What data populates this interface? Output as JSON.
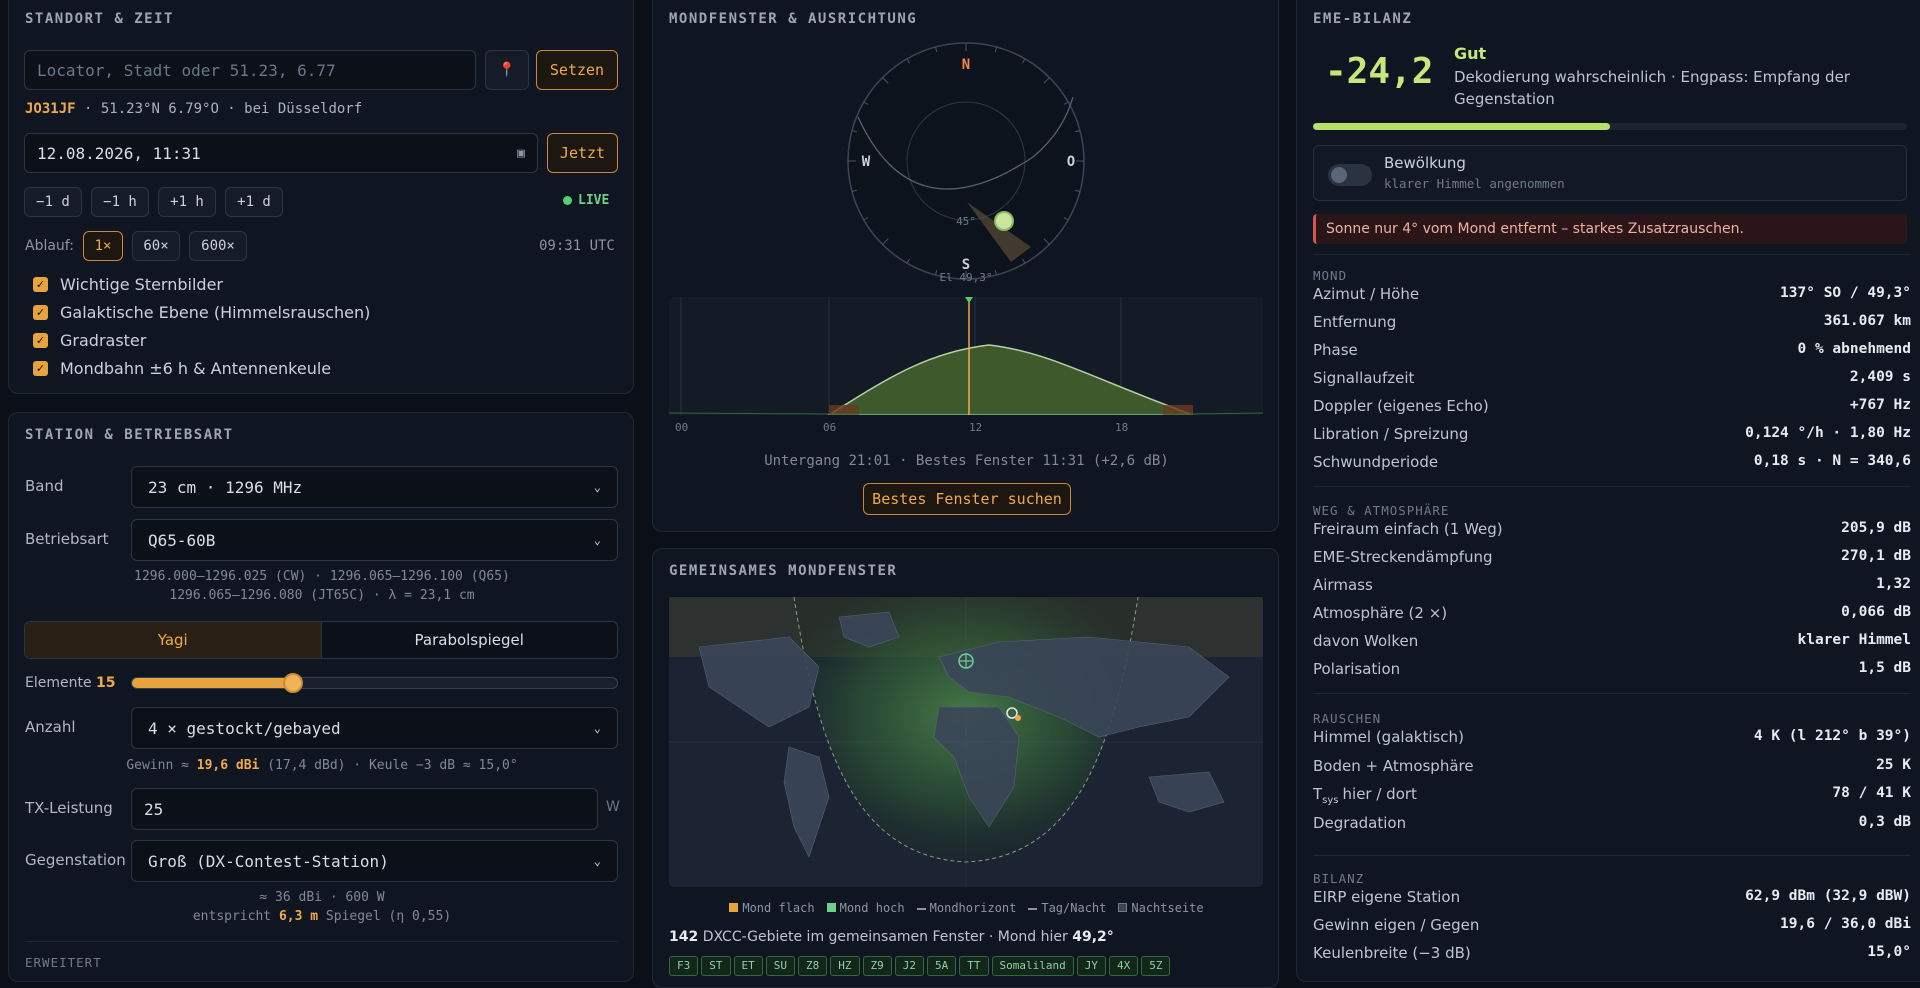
{
  "location": {
    "title": "STANDORT & ZEIT",
    "locator_placeholder": "Locator, Stadt oder 51.23, 6.77",
    "pin_icon": "map-pin-icon",
    "set_label": "Setzen",
    "locator": "JO31JF",
    "coords": "· 51.23°N 6.79°O · bei Düsseldorf",
    "datetime": "12.08.2026, 11:31",
    "now_label": "Jetzt",
    "steps": [
      "−1 d",
      "−1 h",
      "+1 h",
      "+1 d"
    ],
    "live_label": "LIVE",
    "speed_label": "Ablauf:",
    "speeds": [
      "1×",
      "60×",
      "600×"
    ],
    "utc": "09:31 UTC",
    "checks": [
      "Wichtige Sternbilder",
      "Galaktische Ebene (Himmelsrauschen)",
      "Gradraster",
      "Mondbahn ±6 h & Antennenkeule"
    ]
  },
  "station": {
    "title": "STATION & BETRIEBSART",
    "band_label": "Band",
    "band_value": "23 cm · 1296 MHz",
    "mode_label": "Betriebsart",
    "mode_value": "Q65-60B",
    "freq_line1": "1296.000–1296.025 (CW) · 1296.065–1296.100 (Q65)",
    "freq_line2": "1296.065–1296.080 (JT65C) · λ = 23,1 cm",
    "antenna_tabs": [
      "Yagi",
      "Parabolspiegel"
    ],
    "elements_label": "Elemente",
    "elements_value": "15",
    "elements_fraction": 0.33,
    "count_label": "Anzahl",
    "count_value": "4 × gestockt/gebayed",
    "gain_pre": "Gewinn ≈",
    "gain_val": "19,6 dBi",
    "gain_post": "(17,4 dBd) · Keule −3 dB ≈ 15,0°",
    "tx_label": "TX-Leistung",
    "tx_value": "25",
    "tx_unit": "W",
    "peer_label": "Gegenstation",
    "peer_value": "Groß (DX-Contest-Station)",
    "peer_line1": "≈ 36 dBi · 600 W",
    "peer_line2_pre": "entspricht",
    "peer_line2_val": "6,3 m",
    "peer_line2_post": "Spiegel (η 0,55)",
    "advanced": "ERWEITERT"
  },
  "moonwindow": {
    "title": "MONDFENSTER & AUSRICHTUNG",
    "compass": {
      "n": "N",
      "o": "O",
      "s": "S",
      "w": "W",
      "ring45": "45°",
      "el": "El 49,3°"
    },
    "hours": [
      "00",
      "06",
      "12",
      "18"
    ],
    "summary": "Untergang 21:01 · Bestes Fenster 11:31 (+2,6 dB)",
    "best_button": "Bestes Fenster suchen"
  },
  "shared": {
    "title": "GEMEINSAMES MONDFENSTER",
    "legend": [
      "Mond flach",
      "Mond hoch",
      "Mondhorizont",
      "Tag/Nacht",
      "Nachtseite"
    ],
    "count": "142",
    "count_text": "DXCC-Gebiete im gemeinsamen Fenster · Mond hier",
    "moon_el": "49,2°",
    "tags": [
      "F3",
      "ST",
      "ET",
      "SU",
      "Z8",
      "HZ",
      "Z9",
      "J2",
      "5A",
      "TT",
      "Somaliland",
      "JY",
      "4X",
      "5Z"
    ]
  },
  "eme": {
    "title": "EME-BILANZ",
    "margin": "-24,2",
    "verdict": "Gut",
    "verdict_text": "Dekodierung wahrscheinlich · Engpass: Empfang der Gegenstation",
    "bar_fraction": 0.5,
    "cloud_label": "Bewölkung",
    "cloud_sub": "klarer Himmel angenommen",
    "warning": "Sonne nur 4° vom Mond entfernt – starkes Zusatzrauschen.",
    "sections": {
      "moon": "MOND",
      "path": "WEG & ATMOSPHÄRE",
      "noise": "RAUSCHEN",
      "budget": "BILANZ"
    },
    "moon_rows": [
      [
        "Azimut / Höhe",
        "137° SO / 49,3°"
      ],
      [
        "Entfernung",
        "361.067 km"
      ],
      [
        "Phase",
        "0 % abnehmend"
      ],
      [
        "Signallaufzeit",
        "2,409 s"
      ],
      [
        "Doppler (eigenes Echo)",
        "+767 Hz"
      ],
      [
        "Libration / Spreizung",
        "0,124 °/h · 1,80 Hz"
      ],
      [
        "Schwundperiode",
        "0,18 s · N = 340,6"
      ]
    ],
    "path_rows": [
      [
        "Freiraum einfach (1 Weg)",
        "205,9 dB"
      ],
      [
        "EME-Streckendämpfung",
        "270,1 dB"
      ],
      [
        "Airmass",
        "1,32"
      ],
      [
        "Atmosphäre (2 ×)",
        "0,066 dB"
      ],
      [
        "davon Wolken",
        "klarer Himmel"
      ],
      [
        "Polarisation",
        "1,5 dB"
      ]
    ],
    "noise_rows": [
      [
        "Himmel (galaktisch)",
        "4 K (l 212° b 39°)"
      ],
      [
        "Boden + Atmosphäre",
        "25 K"
      ],
      [
        "hier / dort",
        "78 / 41 K"
      ],
      [
        "Degradation",
        "0,3 dB"
      ]
    ],
    "tsys_label": "T",
    "tsys_sub": "sys",
    "budget_rows": [
      [
        "EIRP eigene Station",
        "62,9 dBm (32,9 dBW)"
      ],
      [
        "Gewinn eigen / Gegen",
        "19,6 / 36,0 dBi"
      ],
      [
        "Keulenbreite (−3 dB)",
        "15,0°"
      ]
    ]
  }
}
